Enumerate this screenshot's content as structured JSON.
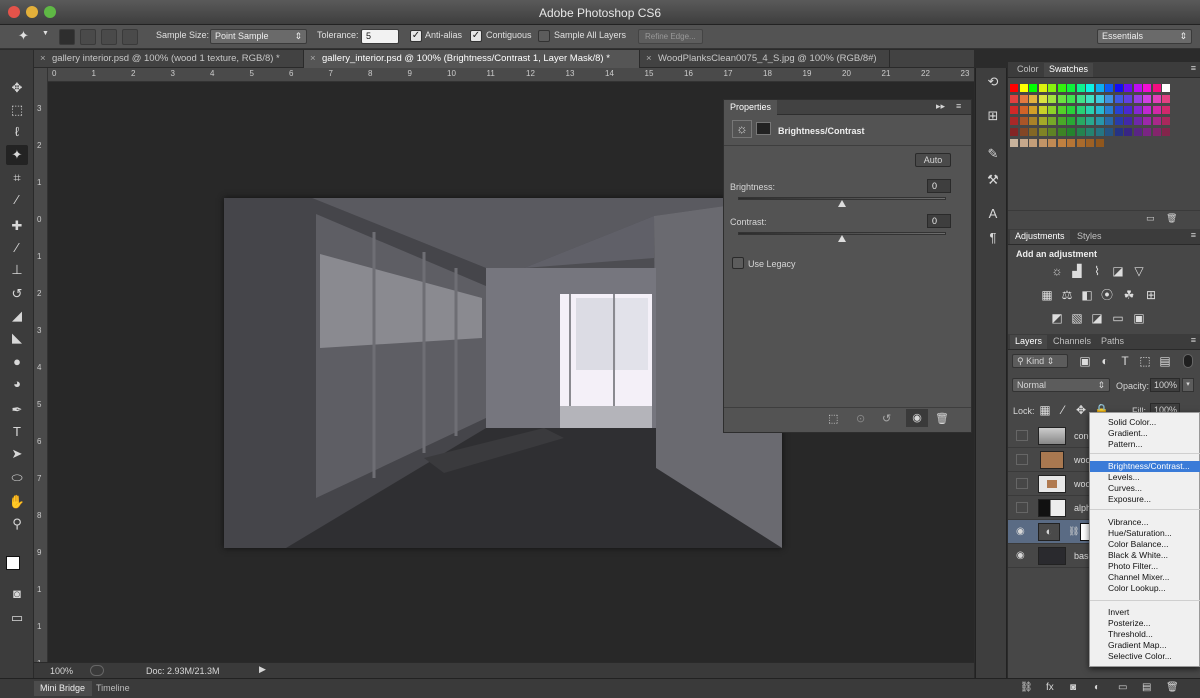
{
  "window": {
    "title": "Adobe Photoshop CS6"
  },
  "options": {
    "sample_size_label": "Sample Size:",
    "sample_size_value": "Point Sample",
    "tolerance_label": "Tolerance:",
    "tolerance_value": "5",
    "anti_alias": {
      "label": "Anti-alias",
      "checked": true
    },
    "contiguous": {
      "label": "Contiguous",
      "checked": true
    },
    "sample_all_layers": {
      "label": "Sample All Layers",
      "checked": false
    },
    "refine_edge": "Refine Edge...",
    "workspace": "Essentials"
  },
  "tabs": [
    {
      "label": "gallery interior.psd @ 100% (wood 1 texture, RGB/8) *",
      "close": "×"
    },
    {
      "label": "gallery_interior.psd @ 100% (Brightness/Contrast 1, Layer Mask/8) *",
      "close": "×"
    },
    {
      "label": "WoodPlanksClean0075_4_S.jpg @ 100% (RGB/8#)",
      "close": "×"
    }
  ],
  "ruler_top": [
    "0",
    "1",
    "2",
    "3",
    "4",
    "5",
    "6",
    "7",
    "8",
    "9",
    "10",
    "11",
    "12",
    "13",
    "14",
    "15",
    "16",
    "17",
    "18",
    "19",
    "20",
    "21",
    "22",
    "23"
  ],
  "ruler_left": [
    "3",
    "2",
    "1",
    "0",
    "1",
    "2",
    "3",
    "4",
    "5",
    "6",
    "7",
    "8",
    "9",
    "1",
    "1",
    "1"
  ],
  "status": {
    "zoom": "100%",
    "doc": "Doc: 2.93M/21.3M"
  },
  "bottom_tabs": [
    "Mini Bridge",
    "Timeline"
  ],
  "properties": {
    "tab": "Properties",
    "adjustment_title": "Brightness/Contrast",
    "auto": "Auto",
    "brightness_label": "Brightness:",
    "brightness_value": "0",
    "contrast_label": "Contrast:",
    "contrast_value": "0",
    "use_legacy": "Use Legacy",
    "brightness_level": 0.5,
    "contrast_level": 0.5
  },
  "color_panel": {
    "tabs": [
      "Color",
      "Swatches"
    ]
  },
  "adjustments_panel": {
    "tabs": [
      "Adjustments",
      "Styles"
    ],
    "heading": "Add an adjustment"
  },
  "layers_panel": {
    "tabs": [
      "Layers",
      "Channels",
      "Paths"
    ],
    "kind": "Kind",
    "blend_mode": "Normal",
    "opacity_label": "Opacity:",
    "opacity_value": "100%",
    "lock_label": "Lock:",
    "fill_label": "Fill:",
    "fill_value": "100%",
    "layers": [
      {
        "name": "conc",
        "visible": false
      },
      {
        "name": "woo",
        "visible": false
      },
      {
        "name": "woo",
        "visible": false
      },
      {
        "name": "alph",
        "visible": false
      },
      {
        "name": "",
        "visible": true
      },
      {
        "name": "base",
        "visible": true
      }
    ]
  },
  "adjustment_menu": {
    "group1": [
      "Solid Color...",
      "Gradient...",
      "Pattern..."
    ],
    "group2": [
      "Brightness/Contrast...",
      "Levels...",
      "Curves...",
      "Exposure..."
    ],
    "group3": [
      "Vibrance...",
      "Hue/Saturation...",
      "Color Balance...",
      "Black & White...",
      "Photo Filter...",
      "Channel Mixer...",
      "Color Lookup..."
    ],
    "group4": [
      "Invert",
      "Posterize...",
      "Threshold...",
      "Gradient Map...",
      "Selective Color..."
    ],
    "highlighted": "Brightness/Contrast..."
  },
  "colors": {
    "highlight": "#3a7bd8",
    "panel": "#535353",
    "canvas": "#282828"
  }
}
